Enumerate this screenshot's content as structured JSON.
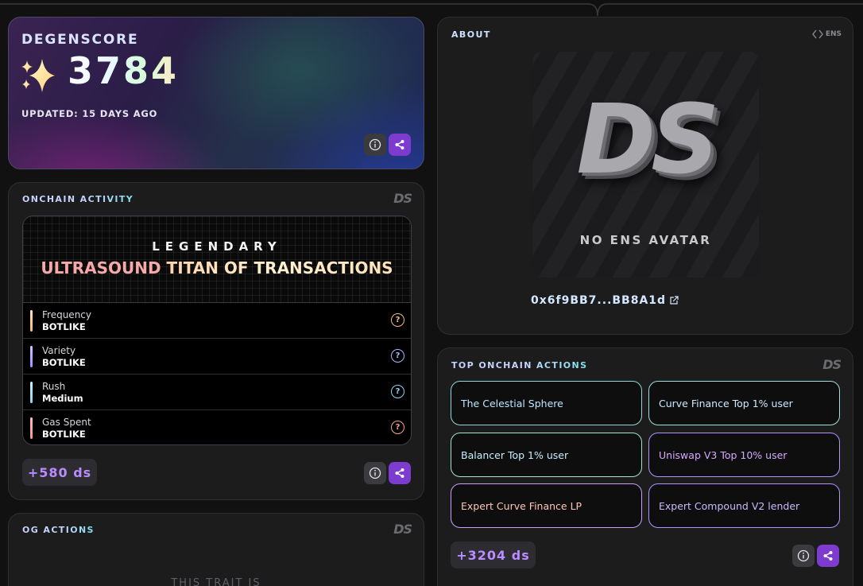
{
  "score_card": {
    "label": "DEGENSCORE",
    "score": "3784",
    "updated": "UPDATED: 15 DAYS AGO"
  },
  "activity": {
    "title": "ONCHAIN ACTIVITY",
    "rank": "LEGENDARY",
    "name_first": "ULTRASOUND",
    "name_rest": " TITAN OF TRANSACTIONS",
    "traits": [
      {
        "name": "Frequency",
        "value": "BOTLIKE",
        "color": "#f4b983"
      },
      {
        "name": "Variety",
        "value": "BOTLIKE",
        "color": "#a48cff"
      },
      {
        "name": "Rush",
        "value": "Medium",
        "color": "#8cd6f5"
      },
      {
        "name": "Gas Spent",
        "value": "BOTLIKE",
        "color": "#f7938e"
      }
    ],
    "ds_points": "+580 ds"
  },
  "og": {
    "title": "OG ACTIONS",
    "message": "THIS TRAIT IS"
  },
  "about": {
    "title": "ABOUT",
    "ens_badge": "ENS",
    "avatar_letters": "DS",
    "no_avatar": "NO ENS AVATAR",
    "address": "0x6f9BB7...BB8A1d"
  },
  "top_actions": {
    "title": "TOP ONCHAIN ACTIONS",
    "items": [
      {
        "label": "The Celestial Sphere",
        "border": "#8fd9d9",
        "text": "#bfe6ff"
      },
      {
        "label": "Curve Finance Top 1% user",
        "border": "#9fe0dc",
        "text": "#cfe9ff"
      },
      {
        "label": "Balancer Top 1% user",
        "border": "#9fe6d4",
        "text": "#c8efff"
      },
      {
        "label": "Uniswap V3 Top 10% user",
        "border": "#b394ff",
        "text": "#d6a9ff"
      },
      {
        "label": "Expert Curve Finance LP",
        "border": "#c9a0ff",
        "text": "#ffc7b5"
      },
      {
        "label": "Expert Compound V2 lender",
        "border": "#b394ff",
        "text": "#cdb8ff"
      }
    ],
    "ds_points": "+3204 ds"
  },
  "colors": {
    "accent": "#7d3ccf",
    "points": "#b98cff"
  }
}
